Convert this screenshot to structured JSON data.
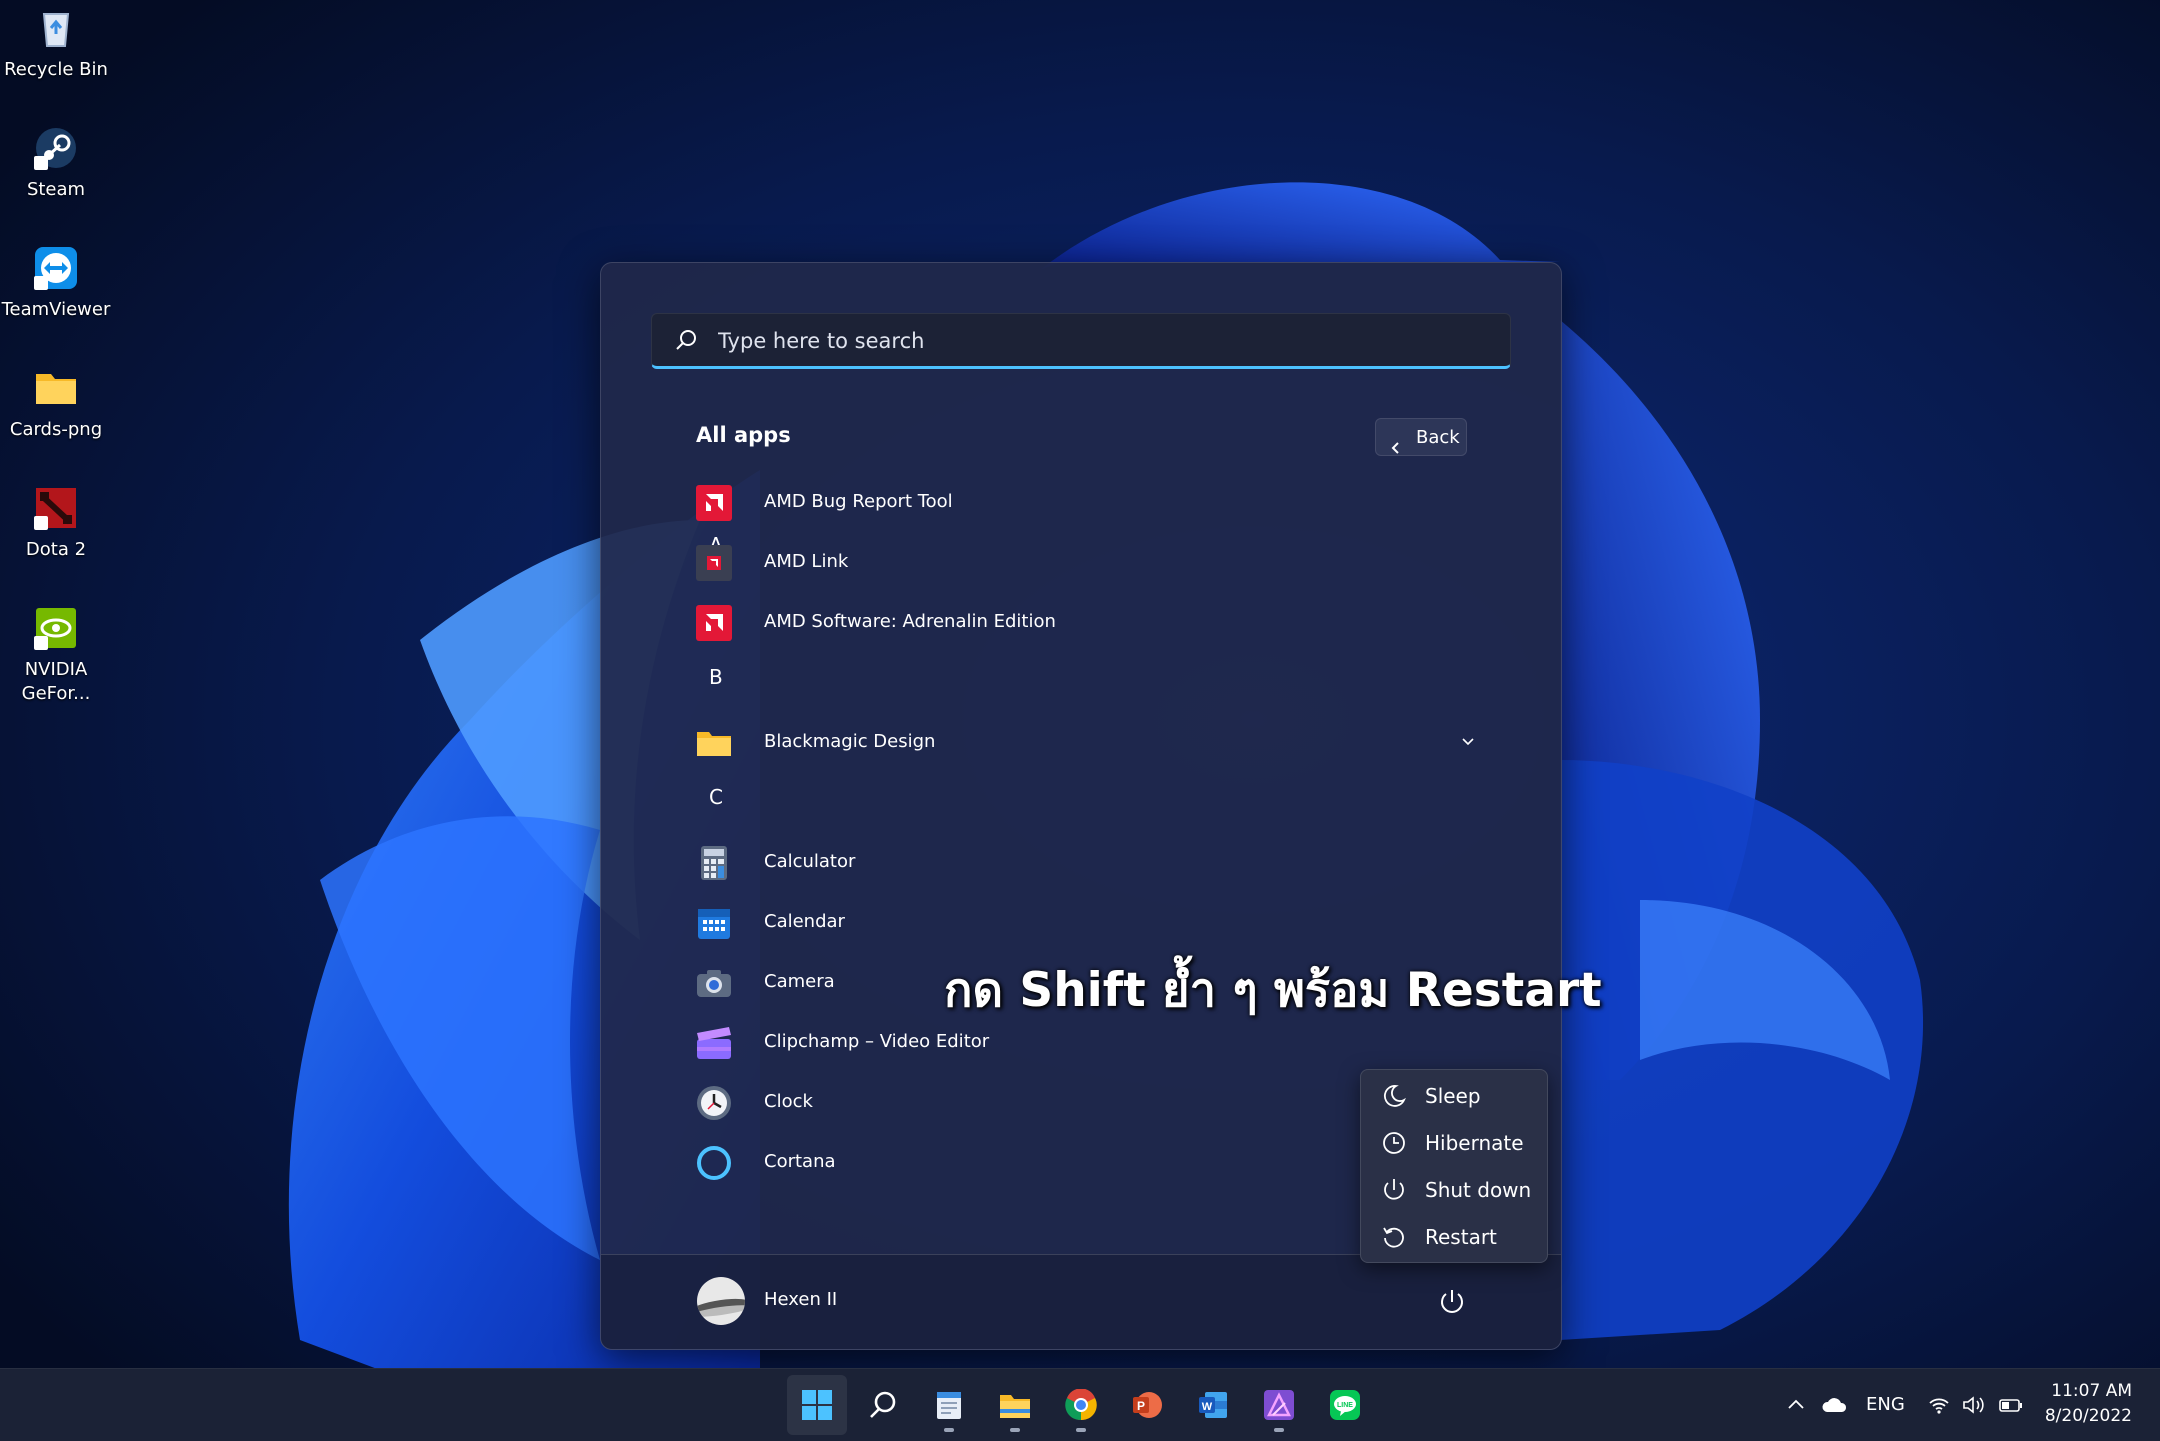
{
  "desktop": {
    "icons": [
      {
        "label": "Recycle Bin",
        "icon": "recycle-bin-icon"
      },
      {
        "label": "Steam",
        "icon": "steam-icon"
      },
      {
        "label": "TeamViewer",
        "icon": "teamviewer-icon"
      },
      {
        "label": "Cards-png",
        "icon": "folder-icon"
      },
      {
        "label": "Dota 2",
        "icon": "dota2-icon"
      },
      {
        "label": "NVIDIA\nGeFor...",
        "icon": "nvidia-geforce-icon"
      }
    ]
  },
  "start_menu": {
    "search_placeholder": "Type here to search",
    "section_title": "All apps",
    "back_label": "Back",
    "groups": [
      {
        "letter": "A",
        "apps": [
          {
            "label": "AMD Bug Report Tool",
            "icon": "amd-icon"
          },
          {
            "label": "AMD Link",
            "icon": "amd-link-icon"
          },
          {
            "label": "AMD Software: Adrenalin Edition",
            "icon": "amd-icon"
          }
        ]
      },
      {
        "letter": "B",
        "apps": [
          {
            "label": "Blackmagic Design",
            "icon": "folder-icon",
            "expandable": true
          }
        ]
      },
      {
        "letter": "C",
        "apps": [
          {
            "label": "Calculator",
            "icon": "calculator-icon"
          },
          {
            "label": "Calendar",
            "icon": "calendar-icon"
          },
          {
            "label": "Camera",
            "icon": "camera-icon"
          },
          {
            "label": "Clipchamp – Video Editor",
            "icon": "clipchamp-icon"
          },
          {
            "label": "Clock",
            "icon": "clock-icon"
          },
          {
            "label": "Cortana",
            "icon": "cortana-icon"
          }
        ]
      }
    ],
    "user_name": "Hexen II"
  },
  "power_menu": {
    "items": [
      {
        "label": "Sleep",
        "icon": "moon-icon"
      },
      {
        "label": "Hibernate",
        "icon": "clock-outline-icon"
      },
      {
        "label": "Shut down",
        "icon": "power-icon"
      },
      {
        "label": "Restart",
        "icon": "restart-icon"
      }
    ]
  },
  "overlay": {
    "caption": "กด Shift ย้ำ ๆ พร้อม Restart"
  },
  "taskbar": {
    "pinned": [
      "start-icon",
      "search-icon",
      "notepad-icon",
      "file-explorer-icon",
      "chrome-icon",
      "powerpoint-icon",
      "word-icon",
      "affinity-photo-icon",
      "line-icon"
    ],
    "tray": {
      "language": "ENG",
      "time": "11:07 AM",
      "date": "8/20/2022"
    }
  },
  "colors": {
    "accent": "#4cc2ff",
    "amd_red": "#e31837",
    "start_menu_bg": "#20284a"
  }
}
